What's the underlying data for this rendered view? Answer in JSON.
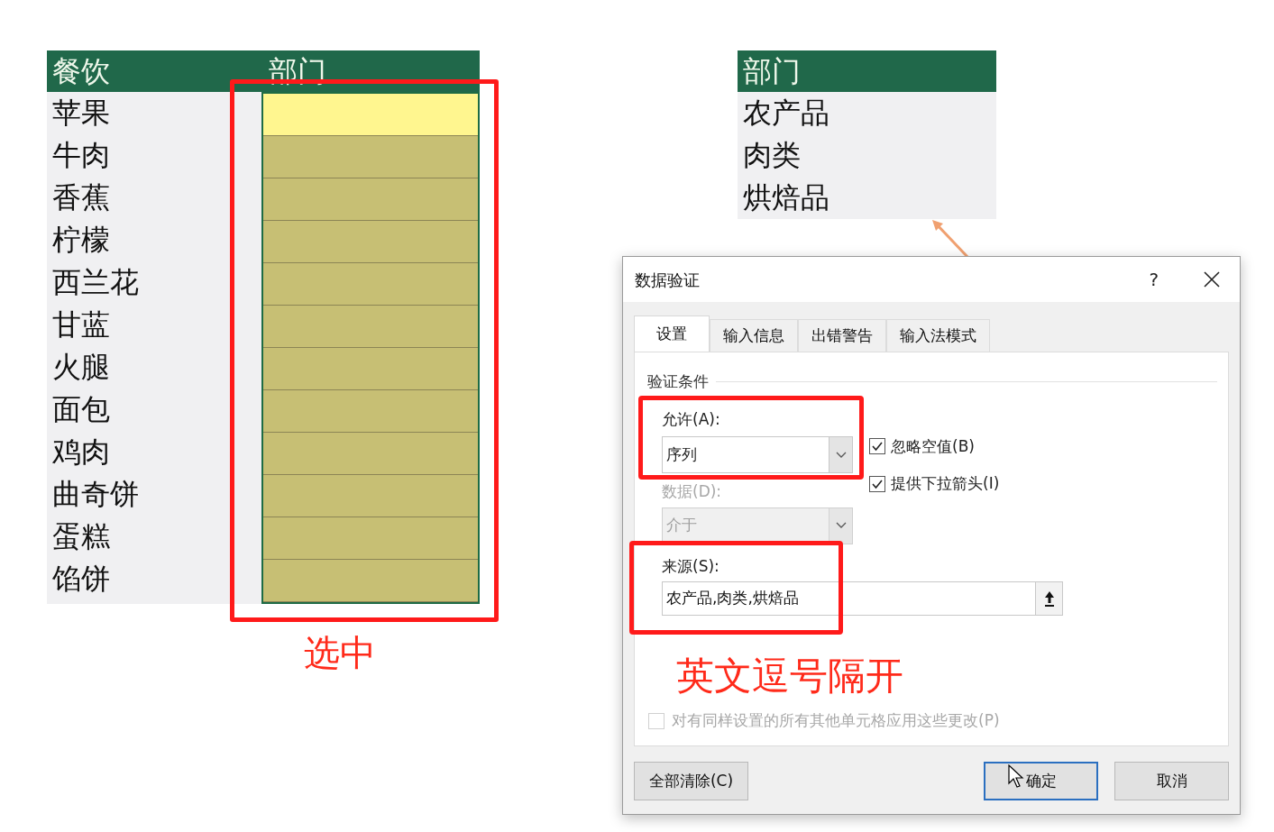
{
  "spreadsheet": {
    "columns": [
      "餐饮",
      "部门"
    ],
    "rows": [
      {
        "item": "苹果",
        "active": true
      },
      {
        "item": "牛肉",
        "active": false
      },
      {
        "item": "香蕉",
        "active": false
      },
      {
        "item": "柠檬",
        "active": false
      },
      {
        "item": "西兰花",
        "active": false
      },
      {
        "item": "甘蓝",
        "active": false
      },
      {
        "item": "火腿",
        "active": false
      },
      {
        "item": "面包",
        "active": false
      },
      {
        "item": "鸡肉",
        "active": false
      },
      {
        "item": "曲奇饼",
        "active": false
      },
      {
        "item": "蛋糕",
        "active": false
      },
      {
        "item": "馅饼",
        "active": false
      }
    ]
  },
  "selection_note": "选中",
  "lookup_table": {
    "header": "部门",
    "rows": [
      "农产品",
      "肉类",
      "烘焙品"
    ]
  },
  "dialog": {
    "title": "数据验证",
    "help": "?",
    "tabs": [
      {
        "label": "设置",
        "selected": true
      },
      {
        "label": "输入信息",
        "selected": false
      },
      {
        "label": "出错警告",
        "selected": false
      },
      {
        "label": "输入法模式",
        "selected": false
      }
    ],
    "section": "验证条件",
    "allow": {
      "label": "允许(A):",
      "value": "序列"
    },
    "options": [
      {
        "label": "忽略空值(B)",
        "checked": true
      },
      {
        "label": "提供下拉箭头(I)",
        "checked": true
      }
    ],
    "data": {
      "label": "数据(D):",
      "value": "介于",
      "disabled": true
    },
    "source": {
      "label": "来源(S):",
      "value": "农产品,肉类,烘焙品"
    },
    "source_note": "英文逗号隔开",
    "apply_all": {
      "label": "对有同样设置的所有其他单元格应用这些更改(P)",
      "checked": false,
      "disabled": true
    },
    "buttons": [
      {
        "label": "全部清除(C)",
        "kind": "clear"
      },
      {
        "label": "确定",
        "kind": "ok"
      },
      {
        "label": "取消",
        "kind": "cancel"
      }
    ]
  }
}
